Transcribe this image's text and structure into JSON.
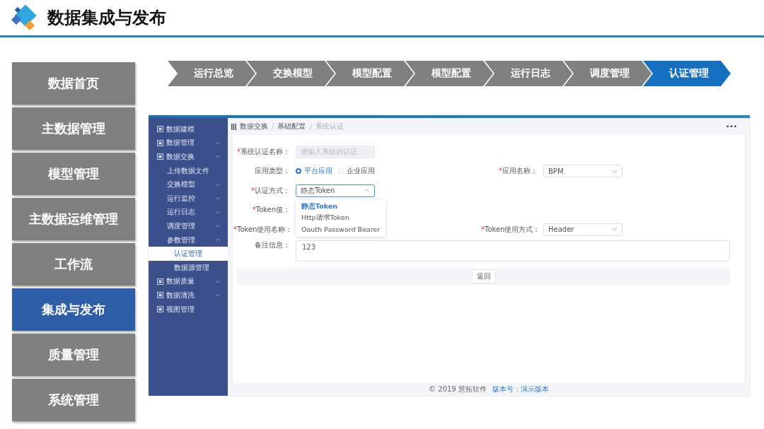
{
  "header": {
    "title": "数据集成与发布"
  },
  "nav_menu": [
    {
      "label": "数据首页",
      "selected": false
    },
    {
      "label": "主数据管理",
      "selected": false
    },
    {
      "label": "模型管理",
      "selected": false
    },
    {
      "label": "主数据运维管理",
      "selected": false
    },
    {
      "label": "工作流",
      "selected": false
    },
    {
      "label": "集成与发布",
      "selected": true
    },
    {
      "label": "质量管理",
      "selected": false
    },
    {
      "label": "系统管理",
      "selected": false
    }
  ],
  "steps": [
    {
      "label": "运行总览",
      "selected": false
    },
    {
      "label": "交换模型",
      "selected": false
    },
    {
      "label": "模型配置",
      "selected": false
    },
    {
      "label": "模型配置",
      "selected": false
    },
    {
      "label": "运行日志",
      "selected": false
    },
    {
      "label": "调度管理",
      "selected": false
    },
    {
      "label": "认证管理",
      "selected": true
    }
  ],
  "app": {
    "sidebar": {
      "items": [
        {
          "label": "数据建模",
          "selected": false
        },
        {
          "label": "数据管理",
          "selected": false,
          "expanded": false
        },
        {
          "label": "数据交换",
          "selected": false,
          "expanded": true,
          "children": [
            {
              "label": "上传数据文件",
              "selected": false
            },
            {
              "label": "交换模型",
              "selected": false,
              "expanded": false
            },
            {
              "label": "运行监控",
              "selected": false,
              "expanded": false
            },
            {
              "label": "运行日志",
              "selected": false,
              "expanded": false
            },
            {
              "label": "调度管理",
              "selected": false,
              "expanded": false
            },
            {
              "label": "参数管理",
              "selected": false,
              "expanded": true,
              "children": [
                {
                  "label": "认证管理",
                  "selected": true
                },
                {
                  "label": "数据源管理",
                  "selected": false
                }
              ]
            }
          ]
        },
        {
          "label": "数据质量",
          "selected": false,
          "expanded": false
        },
        {
          "label": "数据清洗",
          "selected": false,
          "expanded": false
        },
        {
          "label": "视图管理",
          "selected": false
        }
      ]
    },
    "breadcrumb": [
      {
        "label": "数据交换"
      },
      {
        "separator": "/",
        "label": "基础配置"
      },
      {
        "separator": "/",
        "label": "系统认证"
      }
    ],
    "more_button": "•••",
    "form": {
      "rows": [
        {
          "left": {
            "mark": "*",
            "label": "系统认证名称：",
            "kind": "input",
            "placeholder": "请输入系统的认证",
            "disabled": true
          }
        },
        {
          "left": {
            "label": "应用类型：",
            "kind": "radio",
            "options": [
              {
                "label": "平台应用",
                "selected": true
              },
              {
                "label": "企业应用",
                "selected": false
              }
            ]
          },
          "right": {
            "mark": "*",
            "label": "应用名称：",
            "kind": "select",
            "value": "BPM",
            "open": false
          }
        },
        {
          "left": {
            "mark": "*",
            "label": "认证方式：",
            "kind": "select",
            "value": "静态Token",
            "open": true,
            "options": [
              {
                "label": "静态Token",
                "selected": true
              },
              {
                "label": "Http请求Token",
                "selected": false
              },
              {
                "label": "Oauth Password Bearer",
                "selected": false
              }
            ]
          }
        },
        {
          "left": {
            "mark": "*",
            "label": "Token值：",
            "kind": "hidden"
          }
        },
        {
          "left": {
            "mark": "*",
            "label": "Token使用名称：",
            "kind": "hidden"
          },
          "right": {
            "mark": "*",
            "label": "Token使用方式：",
            "kind": "select",
            "value": "Header",
            "open": false
          }
        },
        {
          "left": {
            "label": "备注信息：",
            "kind": "textarea",
            "value": "123"
          }
        }
      ],
      "back_button": "返回"
    },
    "footer": {
      "copyright": "© 2019 慧拓软件",
      "version": "版本号：演示版本"
    }
  }
}
